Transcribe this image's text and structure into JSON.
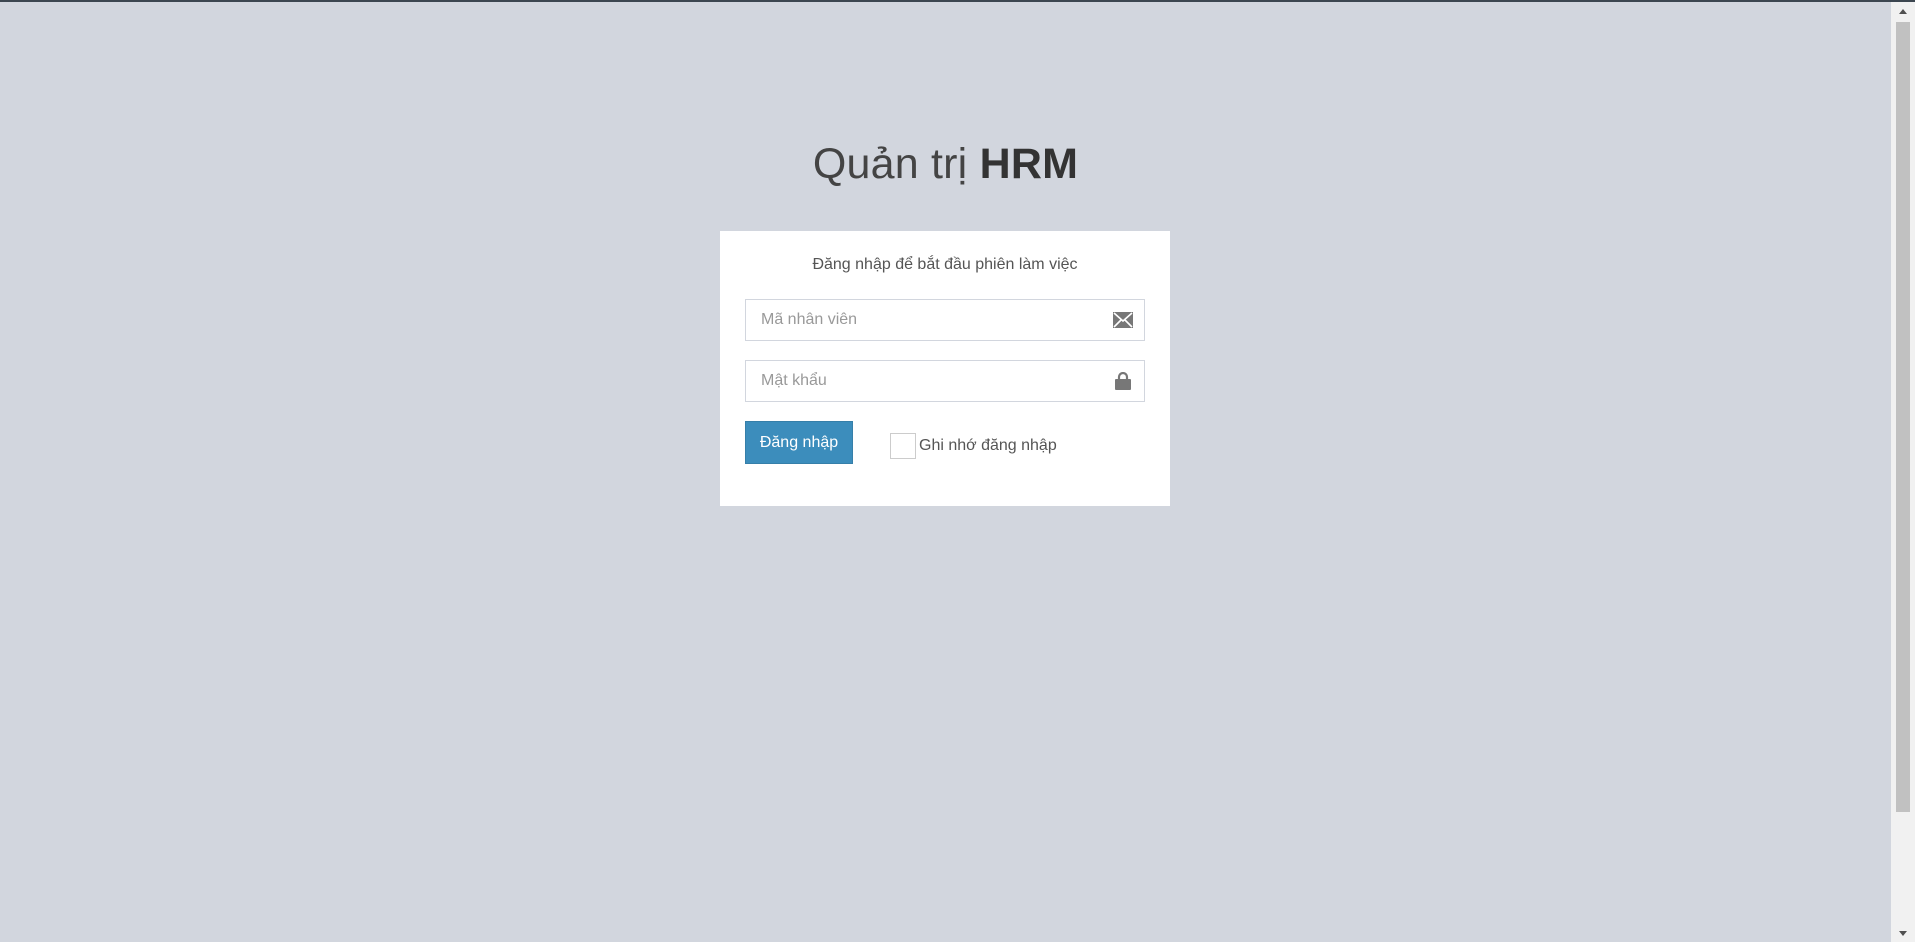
{
  "logo": {
    "light": "Quản trị ",
    "bold": "HRM"
  },
  "login": {
    "message": "Đăng nhập để bắt đầu phiên làm việc",
    "employee_id_placeholder": "Mã nhân viên",
    "employee_id_value": "",
    "password_placeholder": "Mật khẩu",
    "password_value": "",
    "submit_label": "Đăng nhập",
    "remember_label": "Ghi nhớ đăng nhập",
    "remember_checked": false
  },
  "icons": {
    "employee_id": "envelope-icon",
    "password": "lock-icon"
  },
  "colors": {
    "background": "#d2d6de",
    "primary": "#3c8dbc"
  }
}
